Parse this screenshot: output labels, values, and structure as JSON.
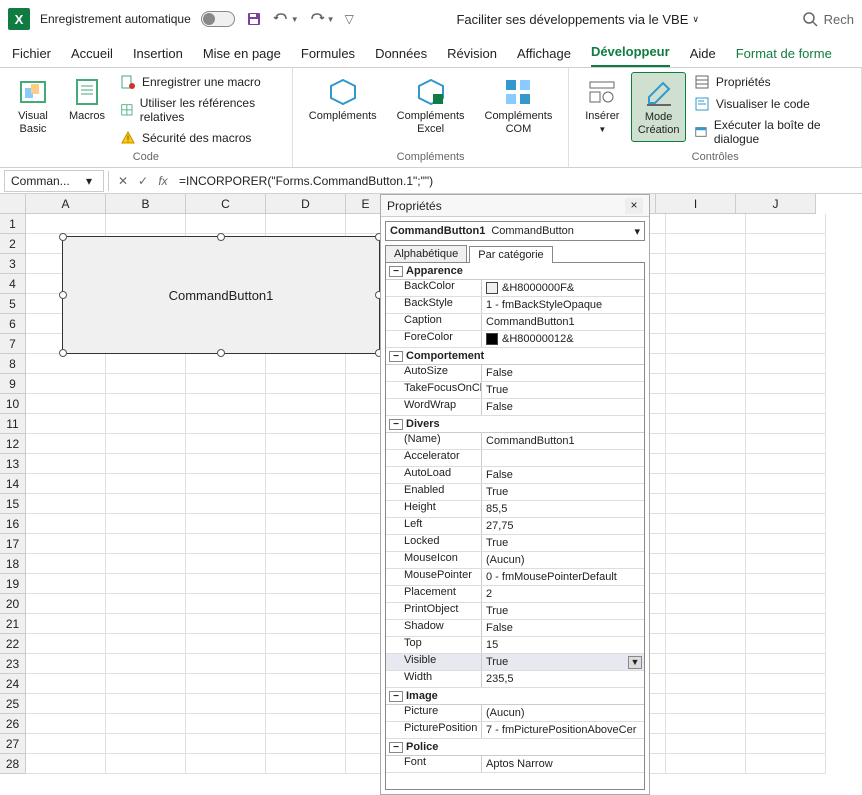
{
  "titlebar": {
    "autosave_label": "Enregistrement automatique",
    "doc_title": "Faciliter ses développements via le VBE",
    "search_placeholder": "Rech"
  },
  "tabs": {
    "fichier": "Fichier",
    "accueil": "Accueil",
    "insertion": "Insertion",
    "mise_en_page": "Mise en page",
    "formules": "Formules",
    "donnees": "Données",
    "revision": "Révision",
    "affichage": "Affichage",
    "developpeur": "Développeur",
    "aide": "Aide",
    "format_forme": "Format de forme"
  },
  "ribbon": {
    "visual_basic": "Visual\nBasic",
    "macros": "Macros",
    "enregistrer_macro": "Enregistrer une macro",
    "references_relatives": "Utiliser les références relatives",
    "securite_macros": "Sécurité des macros",
    "code_group": "Code",
    "complements": "Compléments",
    "complements_excel": "Compléments\nExcel",
    "complements_com": "Compléments\nCOM",
    "complements_group": "Compléments",
    "inserer": "Insérer",
    "mode_creation": "Mode\nCréation",
    "proprietes": "Propriétés",
    "visualiser_code": "Visualiser le code",
    "executer_dialogue": "Exécuter la boîte de dialogue",
    "controles_group": "Contrôles"
  },
  "formula": {
    "namebox": "Comman...",
    "content": "=INCORPORER(\"Forms.CommandButton.1\";\"\")"
  },
  "columns": [
    "A",
    "B",
    "C",
    "D",
    "E",
    "",
    "",
    "",
    "I",
    "J"
  ],
  "button_caption": "CommandButton1",
  "properties": {
    "title": "Propriétés",
    "object_name": "CommandButton1",
    "object_type": "CommandButton",
    "tab_alpha": "Alphabétique",
    "tab_cat": "Par catégorie",
    "cats": {
      "apparence": "Apparence",
      "comportement": "Comportement",
      "divers": "Divers",
      "image": "Image",
      "police": "Police"
    },
    "rows": {
      "BackColor": "&H8000000F&",
      "BackStyle": "1 - fmBackStyleOpaque",
      "Caption": "CommandButton1",
      "ForeColor": "&H80000012&",
      "AutoSize": "False",
      "TakeFocusOnClick": "True",
      "WordWrap": "False",
      "Name": "CommandButton1",
      "Accelerator": "",
      "AutoLoad": "False",
      "Enabled": "True",
      "Height": "85,5",
      "Left": "27,75",
      "Locked": "True",
      "MouseIcon": "(Aucun)",
      "MousePointer": "0 - fmMousePointerDefault",
      "Placement": "2",
      "PrintObject": "True",
      "Shadow": "False",
      "Top": "15",
      "Visible": "True",
      "Width": "235,5",
      "Picture": "(Aucun)",
      "PicturePosition": "7 - fmPicturePositionAboveCer",
      "Font": "Aptos Narrow"
    },
    "keys": {
      "BackColor": "BackColor",
      "BackStyle": "BackStyle",
      "Caption": "Caption",
      "ForeColor": "ForeColor",
      "AutoSize": "AutoSize",
      "TakeFocusOnClick": "TakeFocusOnClick",
      "WordWrap": "WordWrap",
      "Name": "(Name)",
      "Accelerator": "Accelerator",
      "AutoLoad": "AutoLoad",
      "Enabled": "Enabled",
      "Height": "Height",
      "Left": "Left",
      "Locked": "Locked",
      "MouseIcon": "MouseIcon",
      "MousePointer": "MousePointer",
      "Placement": "Placement",
      "PrintObject": "PrintObject",
      "Shadow": "Shadow",
      "Top": "Top",
      "Visible": "Visible",
      "Width": "Width",
      "Picture": "Picture",
      "PicturePosition": "PicturePosition",
      "Font": "Font"
    }
  }
}
